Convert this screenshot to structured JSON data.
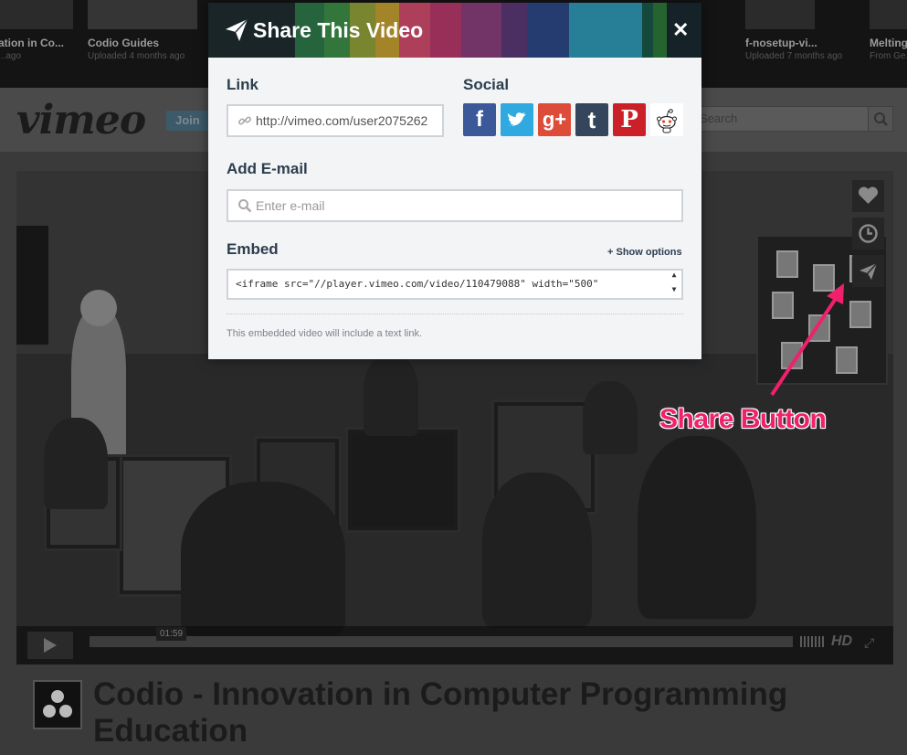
{
  "background": {
    "thumbnails": [
      {
        "title": "ation in Co...",
        "sub": "...ago"
      },
      {
        "title": "Codio Guides",
        "sub": "Uploaded 4 months ago"
      },
      {
        "title": "f-nosetup-vi...",
        "sub": "Uploaded 7 months ago"
      },
      {
        "title": "Melting",
        "sub": "From Ge..."
      }
    ],
    "logo": "vimeo",
    "join_label": "Join",
    "search_placeholder": "Search",
    "player": {
      "time": "01:59",
      "hd_label": "HD"
    },
    "video_title": "Codio - Innovation in Computer Programming Education"
  },
  "annotation": {
    "label": "Share Button",
    "color": "#f0216c"
  },
  "modal": {
    "title": "Share This Video",
    "close_glyph": "✕",
    "link_label": "Link",
    "link_value": "http://vimeo.com/user2075262",
    "social_label": "Social",
    "social_icons": [
      "facebook-icon",
      "twitter-icon",
      "google-plus-icon",
      "tumblr-icon",
      "pinterest-icon",
      "reddit-icon"
    ],
    "social_glyphs": {
      "facebook": "f",
      "twitter": "t",
      "google_plus": "g+",
      "tumblr": "t",
      "pinterest": "P"
    },
    "email_label": "Add E-mail",
    "email_placeholder": "Enter e-mail",
    "embed_label": "Embed",
    "show_options": "+ Show options",
    "embed_code": "<iframe src=\"//player.vimeo.com/video/110479088\" width=\"500\"",
    "note": "This embedded video will include a text link."
  },
  "colors": {
    "facebook": "#3b5998",
    "twitter": "#2fa9e0",
    "google_plus": "#dd4b39",
    "tumblr": "#35465c",
    "pinterest": "#cb2027",
    "label_text": "#2c3e4e"
  }
}
